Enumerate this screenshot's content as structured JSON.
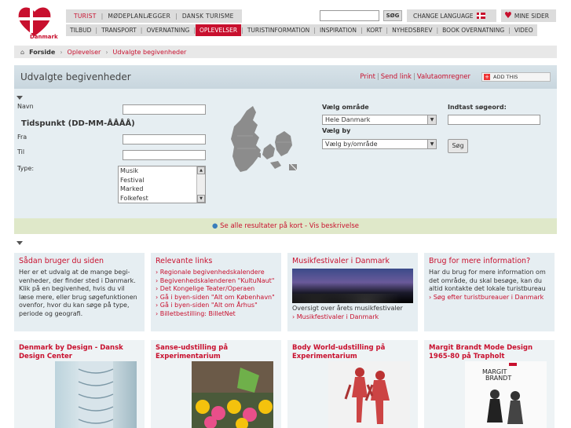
{
  "brand": {
    "logo_text": "Danmark",
    "accent": "#c8102e"
  },
  "topnav": [
    "TURIST",
    "MØDEPLANLÆGGER",
    "DANSK TURISME"
  ],
  "search": {
    "button_label": "SØG",
    "placeholder": ""
  },
  "language_label": "CHANGE LANGUAGE",
  "mine_sider_label": "MINE SIDER",
  "mainnav": [
    "TILBUD",
    "TRANSPORT",
    "OVERNATNING",
    "OPLEVELSER",
    "TURISTINFORMATION",
    "INSPIRATION",
    "KORT",
    "NYHEDSBREV",
    "BOOK OVERNATNING",
    "VIDEO"
  ],
  "breadcrumb": {
    "home": "Forside",
    "items": [
      "Oplevelser",
      "Udvalgte begivenheder"
    ]
  },
  "panel": {
    "title": "Udvalgte begivenheder",
    "tools": [
      "Print",
      "Send link",
      "Valutaomregner"
    ],
    "addthis": "ADD THIS"
  },
  "form": {
    "navn": "Navn",
    "tidspunkt": "Tidspunkt (DD-MM-ÅÅÅÅ)",
    "fra": "Fra",
    "til": "Til",
    "type": "Type:",
    "type_options": [
      "Musik",
      "Festival",
      "Marked",
      "Folkefest"
    ],
    "omraade_label": "Vælg område",
    "omraade_value": "Hele Danmark",
    "by_label": "Vælg by",
    "by_value": "Vælg by/område",
    "soegeord_label": "Indtast søgeord:",
    "soeg_button": "Søg"
  },
  "mapbar": {
    "text": "Se alle resultater på kort - Vis beskrivelse"
  },
  "columns": [
    {
      "title": "Sådan bruger du siden",
      "text": "Her er et udvalg at de mange begi-venheder, der finder sted i Danmark. Klik på en begivenhed, hvis du vil læse mere, eller brug søgefunktionen ovenfor, hvor du kan søge på type, periode og geografi."
    },
    {
      "title": "Relevante links",
      "links": [
        "Regionale begivenhedskalendere",
        "Begivenhedskalenderen \"KultuNaut\"",
        "Det Kongelige Teater/Operaen",
        "Gå i byen-siden \"Alt om København\"",
        "Gå i byen-siden \"Alt om Århus\"",
        "Billetbestilling: BilletNet"
      ]
    },
    {
      "title": "Musikfestivaler i Danmark",
      "text": "Oversigt over årets musikfestivaler",
      "link": "Musikfestivaler i Danmark"
    },
    {
      "title": "Brug for mere information?",
      "text": "Har du brug for mere information om det område, du skal besøge, kan du altid kontakte det lokale turistbureau",
      "link": "Søg efter turistbureauer i Danmark"
    }
  ],
  "cards": [
    {
      "title": "Denmark by Design - Dansk Design Center"
    },
    {
      "title": "Sanse-udstilling på Experimentarium"
    },
    {
      "title": "Body World-udstilling på Experimentarium"
    },
    {
      "title": "Margit Brandt Mode Design 1965-80 på Trapholt"
    }
  ],
  "card_poster_text": [
    "MARGIT",
    "BRANDT"
  ]
}
